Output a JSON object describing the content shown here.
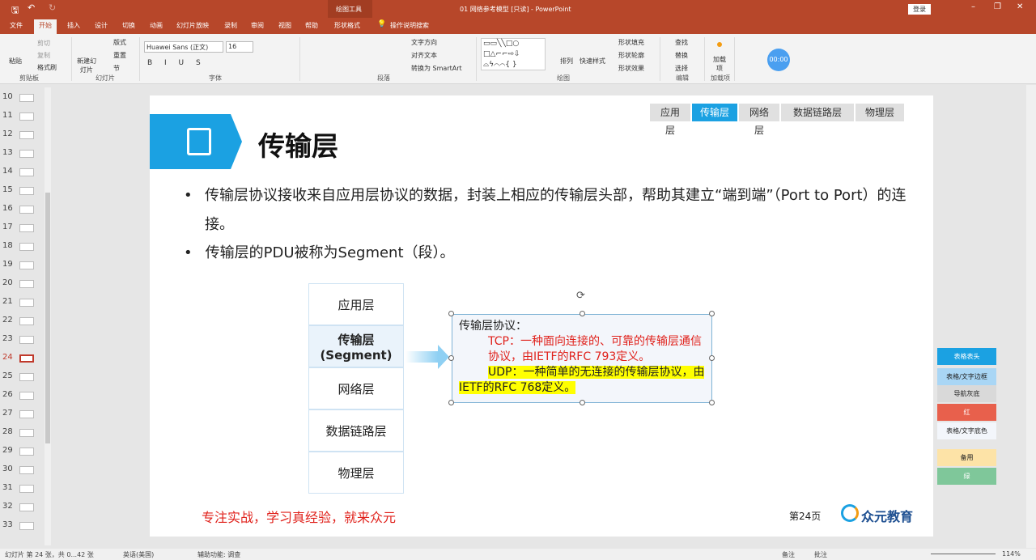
{
  "window": {
    "title": "01 网络参考模型 [只读]  -  PowerPoint",
    "context_tool": "绘图工具",
    "login": "登录"
  },
  "tabs": [
    "文件",
    "开始",
    "插入",
    "设计",
    "切换",
    "动画",
    "幻灯片放映",
    "录制",
    "审阅",
    "视图",
    "帮助",
    "形状格式"
  ],
  "search": "操作说明搜索",
  "ribbon": {
    "clipboard": {
      "paste": "粘贴",
      "cut": "剪切",
      "copy": "复制",
      "painter": "格式刷",
      "label": "剪贴板"
    },
    "slides": {
      "new": "新建幻灯片",
      "layout": "版式",
      "reset": "重置",
      "section": "节",
      "label": "幻灯片"
    },
    "font": {
      "name": "Huawei Sans (正文)",
      "size": "16",
      "label": "字体"
    },
    "paragraph": {
      "direction": "文字方向",
      "align": "对齐文本",
      "smartart": "转换为 SmartArt",
      "label": "段落"
    },
    "drawing": {
      "arrange": "排列",
      "quick": "快速样式",
      "fill": "形状填充",
      "outline": "形状轮廓",
      "effect": "形状效果",
      "label": "绘图"
    },
    "edit": {
      "find": "查找",
      "replace": "替换",
      "select": "选择",
      "label": "编辑"
    },
    "addins": {
      "btn": "加载项",
      "label": "加载项"
    },
    "timer": "00:00"
  },
  "thumbs": [
    "10",
    "11",
    "12",
    "13",
    "14",
    "15",
    "16",
    "17",
    "18",
    "19",
    "20",
    "21",
    "22",
    "23",
    "24",
    "25",
    "26",
    "27",
    "28",
    "29",
    "30",
    "31",
    "32",
    "33"
  ],
  "current_slide": "24",
  "slide": {
    "crumbs": [
      "应用层",
      "传输层",
      "网络层",
      "数据链路层",
      "物理层"
    ],
    "active_crumb": 1,
    "title": "传输层",
    "bullets": [
      "传输层协议接收来自应用层协议的数据，封装上相应的传输层头部，帮助其建立“端到端”（Port to Port）的连接。",
      "传输层的PDU被称为Segment（段）。"
    ],
    "layers": [
      "应用层",
      "传输层",
      "(Segment)",
      "网络层",
      "数据链路层",
      "物理层"
    ],
    "box": {
      "heading": "传输层协议：",
      "tcp": "TCP：一种面向连接的、可靠的传输层通信协议，由IETF的RFC 793定义。",
      "udp": "UDP：一种简单的无连接的传输层协议，由IETF的RFC 768定义。"
    },
    "slogan": "专注实战，学习真经验，就来众元",
    "page": "第24页",
    "logo": "众元教育"
  },
  "side_styles": [
    {
      "label": "表格表头",
      "bg": "#1ba1e2",
      "fg": "#fff"
    },
    {
      "label": "表格/文字边框",
      "bg": "#a9d6f5",
      "fg": "#222"
    },
    {
      "label": "导航灰底",
      "bg": "#d9d9d9",
      "fg": "#222"
    },
    {
      "label": "红",
      "bg": "#e8604c",
      "fg": "#fff"
    },
    {
      "label": "表格/文字底色",
      "bg": "#f3f6fb",
      "fg": "#222"
    },
    {
      "label": "备用",
      "bg": "#fde3a7",
      "fg": "#222"
    },
    {
      "label": "绿",
      "bg": "#7fc79a",
      "fg": "#fff"
    }
  ],
  "status": {
    "slide": "幻灯片 第 24 张，共 0...42 张",
    "lang": "英语(美国)",
    "access": "辅助功能: 调查",
    "notes": "备注",
    "comments": "批注",
    "zoom": "114%"
  }
}
